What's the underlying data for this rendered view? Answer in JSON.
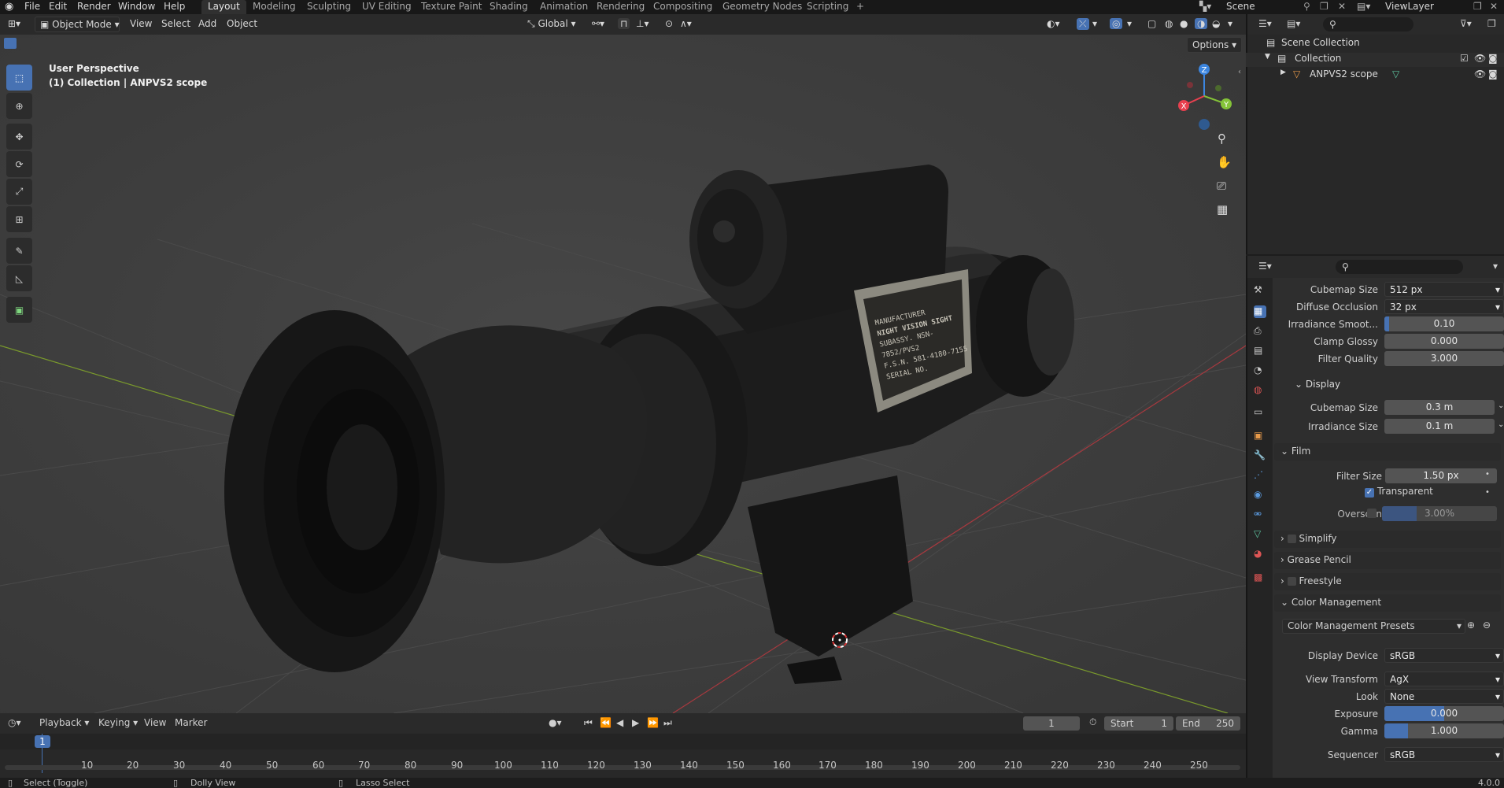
{
  "menu": {
    "file": "File",
    "edit": "Edit",
    "render": "Render",
    "window": "Window",
    "help": "Help"
  },
  "workspaces": [
    "Layout",
    "Modeling",
    "Sculpting",
    "UV Editing",
    "Texture Paint",
    "Shading",
    "Animation",
    "Rendering",
    "Compositing",
    "Geometry Nodes",
    "Scripting"
  ],
  "scene": {
    "name": "Scene",
    "view_layer": "ViewLayer"
  },
  "header3d": {
    "mode": "Object Mode",
    "view": "View",
    "select": "Select",
    "add": "Add",
    "object": "Object",
    "orientation": "Global",
    "options": "Options"
  },
  "viewport": {
    "perspective": "User Perspective",
    "collection_info": "(1) Collection | ANPVS2 scope",
    "gizmo": {
      "x": "X",
      "y": "Y",
      "z": "Z"
    },
    "plate_lines": [
      "MANUFACTURER",
      "NIGHT VISION SIGHT",
      "SUBASSY. NSN-7852/PVS2",
      "F.S.N. 581-4180-7155",
      "SERIAL NO."
    ]
  },
  "outliner": {
    "scene_collection": "Scene Collection",
    "collection": "Collection",
    "object": "ANPVS2 scope"
  },
  "properties": {
    "rows": {
      "cubemap_size": {
        "label": "Cubemap Size",
        "value": "512 px"
      },
      "diffuse_occlusion": {
        "label": "Diffuse Occlusion",
        "value": "32 px"
      },
      "irradiance_smooth": {
        "label": "Irradiance Smoot...",
        "value": "0.10",
        "fraction": 0.04
      },
      "clamp_glossy": {
        "label": "Clamp Glossy",
        "value": "0.000"
      },
      "filter_quality": {
        "label": "Filter Quality",
        "value": "3.000"
      },
      "display_section": "Display",
      "display_cubemap_size": {
        "label": "Cubemap Size",
        "value": "0.3 m"
      },
      "irradiance_size": {
        "label": "Irradiance Size",
        "value": "0.1 m"
      },
      "film_section": "Film",
      "filter_size": {
        "label": "Filter Size",
        "value": "1.50 px"
      },
      "transparent": "Transparent",
      "overscan": {
        "label": "Overscan",
        "value": "3.00%",
        "fraction": 0.3
      },
      "simplify": "Simplify",
      "grease_pencil": "Grease Pencil",
      "freestyle": "Freestyle",
      "color_management": "Color Management",
      "cm_presets": "Color Management Presets",
      "display_device": {
        "label": "Display Device",
        "value": "sRGB"
      },
      "view_transform": {
        "label": "View Transform",
        "value": "AgX"
      },
      "look": {
        "label": "Look",
        "value": "None"
      },
      "exposure": {
        "label": "Exposure",
        "value": "0.000",
        "fraction": 0.5
      },
      "gamma": {
        "label": "Gamma",
        "value": "1.000",
        "fraction": 0.2
      },
      "sequencer": {
        "label": "Sequencer",
        "value": "sRGB"
      }
    }
  },
  "timeline": {
    "playback": "Playback",
    "keying": "Keying",
    "view": "View",
    "marker": "Marker",
    "current_frame": "1",
    "start_label": "Start",
    "start": "1",
    "end_label": "End",
    "end": "250",
    "ticks": [
      "1",
      "10",
      "20",
      "30",
      "40",
      "50",
      "60",
      "70",
      "80",
      "90",
      "100",
      "110",
      "120",
      "130",
      "140",
      "150",
      "160",
      "170",
      "180",
      "190",
      "200",
      "210",
      "220",
      "230",
      "240",
      "250"
    ]
  },
  "status": {
    "select": "Select (Toggle)",
    "dolly": "Dolly View",
    "lasso": "Lasso Select",
    "version": "4.0.0"
  },
  "colors": {
    "accent": "#4772b3",
    "x_axis": "#e8404f",
    "y_axis": "#84c338",
    "z_axis": "#3c86e0"
  }
}
